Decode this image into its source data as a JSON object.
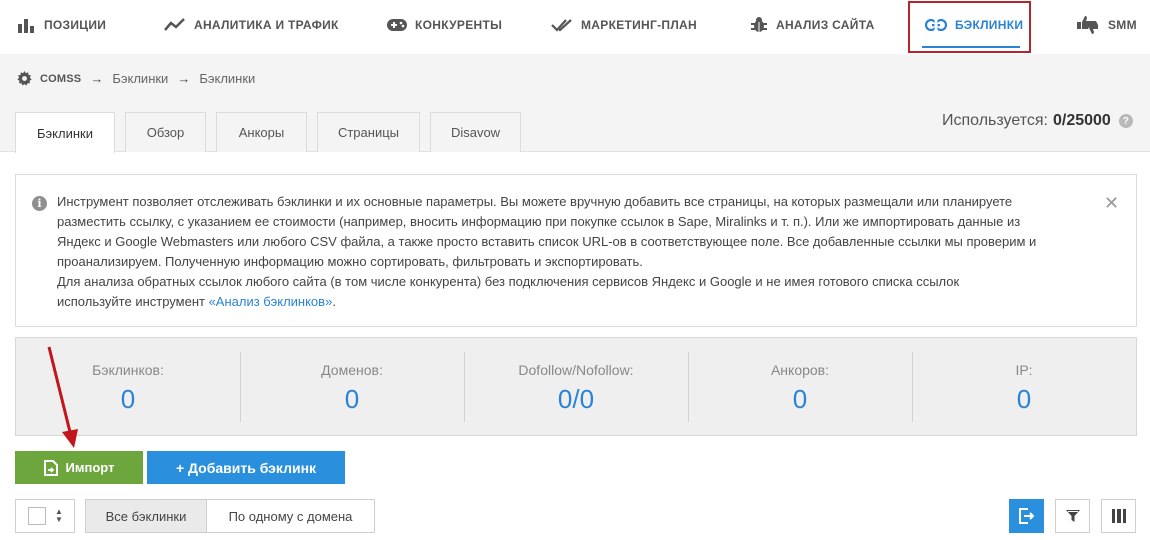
{
  "nav": {
    "items": [
      {
        "label": "ПОЗИЦИИ",
        "icon": "bar-chart-icon"
      },
      {
        "label": "АНАЛИТИКА И ТРАФИК",
        "icon": "trend-line-icon"
      },
      {
        "label": "КОНКУРЕНТЫ",
        "icon": "gamepad-icon"
      },
      {
        "label": "МАРКЕТИНГ-ПЛАН",
        "icon": "double-check-icon"
      },
      {
        "label": "АНАЛИЗ САЙТА",
        "icon": "bug-icon"
      },
      {
        "label": "БЭКЛИНКИ",
        "icon": "link-icon"
      },
      {
        "label": "SMM",
        "icon": "thumbs-icon"
      }
    ],
    "active": "БЭКЛИНКИ",
    "active_color": "#2a83d6",
    "highlight_color": "#b3262b"
  },
  "breadcrumb": {
    "root": "COMSS",
    "items": [
      "Бэклинки",
      "Бэклинки"
    ],
    "separator": "→"
  },
  "tabs": [
    {
      "label": "Бэклинки",
      "active": true
    },
    {
      "label": "Обзор",
      "active": false
    },
    {
      "label": "Анкоры",
      "active": false
    },
    {
      "label": "Страницы",
      "active": false
    },
    {
      "label": "Disavow",
      "active": false
    }
  ],
  "usage": {
    "label": "Используется:",
    "value": "0/25000",
    "help": "?"
  },
  "info": {
    "icon": "i",
    "line1": "Инструмент позволяет отслеживать бэклинки и их основные параметры. Вы можете вручную добавить все страницы, на которых размещали или планируете",
    "line2": "разместить ссылку, с указанием ее стоимости (например, вносить информацию при покупке ссылок в Sape, Miralinks и т. п.). Или же импортировать данные из",
    "line3": "Яндекс и Google Webmasters или любого CSV файла, а также просто вставить список URL-ов в соответствующее поле. Все добавленные ссылки мы проверим и",
    "line4": "проанализируем. Полученную информацию можно сортировать, фильтровать и экспортировать.",
    "line5": "Для анализа обратных ссылок любого сайта (в том числе конкурента) без подключения сервисов Яндекс и Google и не имея готового списка ссылок",
    "line6_prefix": "используйте инструмент ",
    "link_text": "«Анализ бэклинков»",
    "line6_suffix": ".",
    "close": "✕"
  },
  "stats": [
    {
      "label": "Бэклинков:",
      "value": "0"
    },
    {
      "label": "Доменов:",
      "value": "0"
    },
    {
      "label": "Dofollow/Nofollow:",
      "value": "0/0"
    },
    {
      "label": "Анкоров:",
      "value": "0"
    },
    {
      "label": "IP:",
      "value": "0"
    }
  ],
  "actions": {
    "import_label": "Импорт",
    "add_label": "+ Добавить бэклинк",
    "import_color": "#6da63c",
    "add_color": "#2a90de"
  },
  "filters": {
    "all_label": "Все бэклинки",
    "one_per_domain_label": "По одному с домена"
  },
  "toolbar_icons": [
    "export-icon",
    "filter-icon",
    "columns-icon"
  ]
}
